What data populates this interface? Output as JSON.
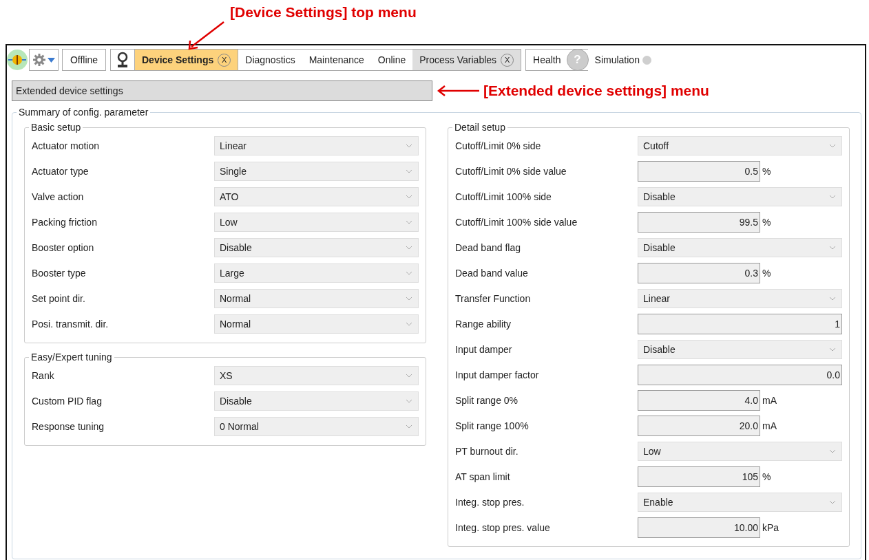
{
  "annotations": [
    {
      "text": "[Device Settings] top menu"
    },
    {
      "text": "[Extended device settings] menu"
    }
  ],
  "toolbar": {
    "offline": "Offline",
    "tabs": [
      {
        "label": "Device Settings",
        "selected": true,
        "closable": true,
        "close": "X"
      },
      {
        "label": "Diagnostics",
        "selected": false,
        "closable": false
      },
      {
        "label": "Maintenance",
        "selected": false,
        "closable": false
      },
      {
        "label": "Online",
        "selected": false,
        "closable": false
      },
      {
        "label": "Process Variables",
        "selected": false,
        "closable": true,
        "close": "X"
      }
    ],
    "health": "Health",
    "help": "?",
    "simulation": {
      "label": "Simulation",
      "on": false
    }
  },
  "menu": "Extended device settings",
  "summary": {
    "title": "Summary of config. parameter",
    "left": [
      {
        "title": "Basic setup",
        "rows": [
          {
            "label": "Actuator motion",
            "kind": "select",
            "value": "Linear"
          },
          {
            "label": "Actuator type",
            "kind": "select",
            "value": "Single"
          },
          {
            "label": "Valve action",
            "kind": "select",
            "value": "ATO"
          },
          {
            "label": "Packing friction",
            "kind": "select",
            "value": "Low"
          },
          {
            "label": "Booster option",
            "kind": "select",
            "value": "Disable"
          },
          {
            "label": "Booster type",
            "kind": "select",
            "value": "Large"
          },
          {
            "label": "Set point dir.",
            "kind": "select",
            "value": "Normal"
          },
          {
            "label": "Posi. transmit. dir.",
            "kind": "select",
            "value": "Normal"
          }
        ]
      },
      {
        "title": "Easy/Expert tuning",
        "rows": [
          {
            "label": "Rank",
            "kind": "select",
            "value": "XS"
          },
          {
            "label": "Custom PID flag",
            "kind": "select",
            "value": "Disable"
          },
          {
            "label": "Response tuning",
            "kind": "select",
            "value": "0 Normal"
          }
        ]
      }
    ],
    "right": [
      {
        "title": "Detail setup",
        "rows": [
          {
            "label": "Cutoff/Limit 0% side",
            "kind": "select",
            "value": "Cutoff"
          },
          {
            "label": "Cutoff/Limit 0% side value",
            "kind": "number",
            "value": "0.5",
            "unit": "%"
          },
          {
            "label": "Cutoff/Limit 100% side",
            "kind": "select",
            "value": "Disable"
          },
          {
            "label": "Cutoff/Limit 100% side value",
            "kind": "number",
            "value": "99.5",
            "unit": "%"
          },
          {
            "label": "Dead band flag",
            "kind": "select",
            "value": "Disable"
          },
          {
            "label": "Dead band value",
            "kind": "number",
            "value": "0.3",
            "unit": "%"
          },
          {
            "label": "Transfer Function",
            "kind": "select",
            "value": "Linear"
          },
          {
            "label": "Range ability",
            "kind": "number",
            "value": "1"
          },
          {
            "label": "Input damper",
            "kind": "select",
            "value": "Disable"
          },
          {
            "label": "Input damper factor",
            "kind": "number",
            "value": "0.0"
          },
          {
            "label": "Split range 0%",
            "kind": "number",
            "value": "4.0",
            "unit": "mA"
          },
          {
            "label": "Split range 100%",
            "kind": "number",
            "value": "20.0",
            "unit": "mA"
          },
          {
            "label": "PT burnout dir.",
            "kind": "select",
            "value": "Low"
          },
          {
            "label": "AT span limit",
            "kind": "number",
            "value": "105",
            "unit": "%"
          },
          {
            "label": "Integ. stop pres.",
            "kind": "select",
            "value": "Enable"
          },
          {
            "label": "Integ. stop pres. value",
            "kind": "number",
            "value": "10.00",
            "unit": "kPa"
          }
        ]
      }
    ]
  }
}
